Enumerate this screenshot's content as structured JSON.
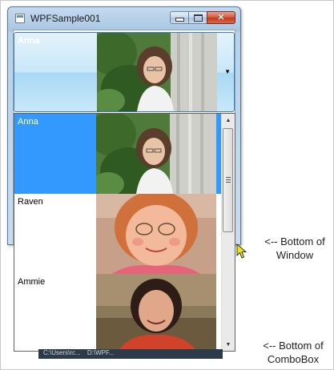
{
  "window": {
    "title": "WPFSample001",
    "close_symbol": "✕"
  },
  "combobox": {
    "selected_label": "Anna",
    "items": [
      {
        "label": "Anna",
        "photo": "photo-girl-by-pillar"
      },
      {
        "label": "Raven",
        "photo": "photo-red-haired-child"
      },
      {
        "label": "Ammie",
        "photo": "photo-woman-smiling"
      }
    ]
  },
  "annotations": {
    "bottom_window_line1": "<-- Bottom of",
    "bottom_window_line2": "Window",
    "bottom_combo_line1": "<-- Bottom of",
    "bottom_combo_line2": "ComboBox"
  },
  "taskbar": {
    "item1": "C:\\Users\\rc...",
    "item2": "D:\\WPF..."
  },
  "colors": {
    "selection": "#3399ff",
    "combo_border": "#3c7fb1"
  }
}
